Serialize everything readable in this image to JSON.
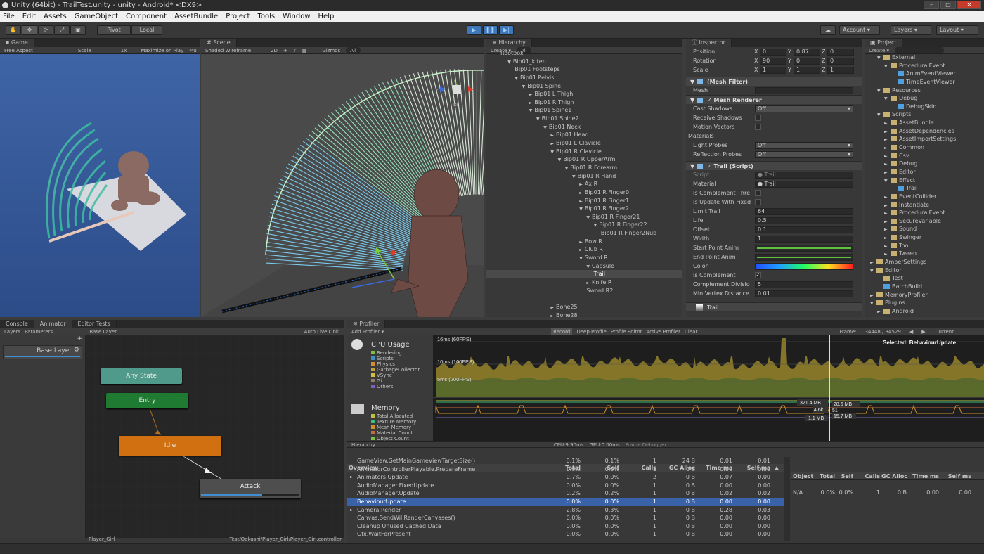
{
  "title": "Unity (64bit) - TrailTest.unity - unity - Android* <DX9>",
  "menu": [
    "File",
    "Edit",
    "Assets",
    "GameObject",
    "Component",
    "AssetBundle",
    "Project",
    "Tools",
    "Window",
    "Help"
  ],
  "toolbar": {
    "pivot": "Pivot",
    "local": "Local",
    "account": "Account",
    "layers": "Layers",
    "layout": "Layout"
  },
  "game": {
    "tab": "Game",
    "aspect": "Free Aspect",
    "scale_label": "Scale",
    "scale_value": "1x",
    "maximize": "Maximize on Play",
    "mute": "Mu"
  },
  "scene": {
    "tab": "Scene",
    "mode": "Shaded Wireframe",
    "twod": "2D",
    "gizmos": "Gizmos",
    "search": "All",
    "persp": "Iso"
  },
  "hierarchy": {
    "tab": "Hierarchy",
    "create": "Create",
    "search": "All",
    "rows": [
      {
        "t": "Rootbox",
        "d": 0,
        "a": ""
      },
      {
        "t": "Bip01_kiten",
        "d": 1,
        "a": "▼"
      },
      {
        "t": "Bip01 Footsteps",
        "d": 2,
        "a": ""
      },
      {
        "t": "Bip01 Pelvis",
        "d": 2,
        "a": "▼"
      },
      {
        "t": "Bip01 Spine",
        "d": 3,
        "a": "▼"
      },
      {
        "t": "Bip01 L Thigh",
        "d": 4,
        "a": "►"
      },
      {
        "t": "Bip01 R Thigh",
        "d": 4,
        "a": "►"
      },
      {
        "t": "Bip01 Spine1",
        "d": 4,
        "a": "▼"
      },
      {
        "t": "Bip01 Spine2",
        "d": 5,
        "a": "▼"
      },
      {
        "t": "Bip01 Neck",
        "d": 6,
        "a": "▼"
      },
      {
        "t": "Bip01 Head",
        "d": 7,
        "a": "►"
      },
      {
        "t": "Bip01 L Clavicle",
        "d": 7,
        "a": "►"
      },
      {
        "t": "Bip01 R Clavicle",
        "d": 7,
        "a": "▼"
      },
      {
        "t": "Bip01 R UpperArm",
        "d": 8,
        "a": "▼"
      },
      {
        "t": "Bip01 R Forearm",
        "d": 9,
        "a": "▼"
      },
      {
        "t": "Bip01 R Hand",
        "d": 10,
        "a": "▼"
      },
      {
        "t": "Ax R",
        "d": 11,
        "a": "►"
      },
      {
        "t": "Bip01 R Finger0",
        "d": 11,
        "a": "►"
      },
      {
        "t": "Bip01 R Finger1",
        "d": 11,
        "a": "►"
      },
      {
        "t": "Bip01 R Finger2",
        "d": 11,
        "a": "▼"
      },
      {
        "t": "Bip01 R Finger21",
        "d": 12,
        "a": "▼"
      },
      {
        "t": "Bip01 R Finger22",
        "d": 13,
        "a": "▼"
      },
      {
        "t": "Bip01 R Finger2Nub",
        "d": 14,
        "a": ""
      },
      {
        "t": "Bow R",
        "d": 11,
        "a": "►"
      },
      {
        "t": "Club R",
        "d": 11,
        "a": "►"
      },
      {
        "t": "Sword R",
        "d": 11,
        "a": "▼"
      },
      {
        "t": "Capsule",
        "d": 12,
        "a": "▼"
      },
      {
        "t": "Trail",
        "d": 13,
        "a": "",
        "sel": true
      },
      {
        "t": "Knife R",
        "d": 12,
        "a": "►"
      },
      {
        "t": "Sword R2",
        "d": 12,
        "a": ""
      },
      {
        "t": "",
        "d": 0,
        "a": ""
      },
      {
        "t": "Bone25",
        "d": 7,
        "a": "►"
      },
      {
        "t": "Bone28",
        "d": 7,
        "a": "►"
      }
    ]
  },
  "inspector": {
    "tab": "Inspector",
    "transform": [
      {
        "label": "Position",
        "x": "0",
        "y": "0.87",
        "z": "0"
      },
      {
        "label": "Rotation",
        "x": "90",
        "y": "0",
        "z": "0"
      },
      {
        "label": "Scale",
        "x": "1",
        "y": "1",
        "z": "1"
      }
    ],
    "xyz": [
      "X",
      "Y",
      "Z"
    ],
    "mesh_filter": {
      "title": "(Mesh Filter)",
      "mesh_label": "Mesh"
    },
    "mesh_renderer": {
      "title": "Mesh Renderer",
      "rows": [
        {
          "label": "Cast Shadows",
          "value": "Off",
          "kind": "drop"
        },
        {
          "label": "Receive Shadows",
          "value": "",
          "kind": "check"
        },
        {
          "label": "Motion Vectors",
          "value": "",
          "kind": "check"
        },
        {
          "label": "Materials",
          "value": "",
          "kind": "fold"
        },
        {
          "label": "Light Probes",
          "value": "Off",
          "kind": "drop"
        },
        {
          "label": "Reflection Probes",
          "value": "Off",
          "kind": "drop"
        }
      ]
    },
    "trail": {
      "title": "Trail (Script)",
      "rows": [
        {
          "label": "Script",
          "value": "Trail",
          "kind": "obj",
          "dim": true
        },
        {
          "label": "Material",
          "value": "Trail",
          "kind": "obj"
        },
        {
          "label": "Is Complement Thre",
          "value": "",
          "kind": "check"
        },
        {
          "label": "Is Update With Fixed",
          "value": "",
          "kind": "check"
        },
        {
          "label": "Limit Trail",
          "value": "64",
          "kind": "text"
        },
        {
          "label": "Life",
          "value": "0.5",
          "kind": "text"
        },
        {
          "label": "Offset",
          "value": "0.1",
          "kind": "text"
        },
        {
          "label": "Width",
          "value": "1",
          "kind": "text"
        },
        {
          "label": "Start Point Anim",
          "value": "",
          "kind": "curve"
        },
        {
          "label": "End Point Anim",
          "value": "",
          "kind": "curve"
        },
        {
          "label": "Color",
          "value": "",
          "kind": "gradient"
        },
        {
          "label": "Is Complement",
          "value": "✓",
          "kind": "checked"
        },
        {
          "label": "Complement Divisio",
          "value": "5",
          "kind": "text"
        },
        {
          "label": "Min Vertex Distance",
          "value": "0.01",
          "kind": "text"
        }
      ]
    },
    "footer": "Trail"
  },
  "project": {
    "tab": "Project",
    "create": "Create",
    "rows": [
      {
        "t": "External",
        "d": 1,
        "a": "▼",
        "f": true
      },
      {
        "t": "ProceduralEvent",
        "d": 2,
        "a": "▼",
        "f": true
      },
      {
        "t": "AnimEventViewer",
        "d": 3,
        "a": "",
        "f": false
      },
      {
        "t": "TimeEventViewer",
        "d": 3,
        "a": "",
        "f": false
      },
      {
        "t": "Resources",
        "d": 1,
        "a": "▼",
        "f": true
      },
      {
        "t": "Debug",
        "d": 2,
        "a": "▼",
        "f": true
      },
      {
        "t": "DebugSkin",
        "d": 3,
        "a": "",
        "f": false
      },
      {
        "t": "Scripts",
        "d": 1,
        "a": "▼",
        "f": true
      },
      {
        "t": "AssetBundle",
        "d": 2,
        "a": "►",
        "f": true
      },
      {
        "t": "AssetDependencies",
        "d": 2,
        "a": "►",
        "f": true
      },
      {
        "t": "AssetImportSettings",
        "d": 2,
        "a": "►",
        "f": true
      },
      {
        "t": "Common",
        "d": 2,
        "a": "►",
        "f": true
      },
      {
        "t": "Csv",
        "d": 2,
        "a": "►",
        "f": true
      },
      {
        "t": "Debug",
        "d": 2,
        "a": "►",
        "f": true
      },
      {
        "t": "Editor",
        "d": 2,
        "a": "►",
        "f": true
      },
      {
        "t": "Effect",
        "d": 2,
        "a": "▼",
        "f": true
      },
      {
        "t": "Trail",
        "d": 3,
        "a": "",
        "f": false
      },
      {
        "t": "EventCollider",
        "d": 2,
        "a": "►",
        "f": true
      },
      {
        "t": "Instantiate",
        "d": 2,
        "a": "►",
        "f": true
      },
      {
        "t": "ProceduralEvent",
        "d": 2,
        "a": "►",
        "f": true
      },
      {
        "t": "SecureVariable",
        "d": 2,
        "a": "►",
        "f": true
      },
      {
        "t": "Sound",
        "d": 2,
        "a": "►",
        "f": true
      },
      {
        "t": "Swinger",
        "d": 2,
        "a": "►",
        "f": true
      },
      {
        "t": "Tool",
        "d": 2,
        "a": "►",
        "f": true
      },
      {
        "t": "Tween",
        "d": 2,
        "a": "►",
        "f": true
      },
      {
        "t": "AmberSettings",
        "d": 0,
        "a": "►",
        "f": true
      },
      {
        "t": "Editor",
        "d": 0,
        "a": "▼",
        "f": true
      },
      {
        "t": "Test",
        "d": 1,
        "a": "",
        "f": true
      },
      {
        "t": "BatchBuild",
        "d": 1,
        "a": "",
        "f": false
      },
      {
        "t": "MemoryProfiler",
        "d": 0,
        "a": "►",
        "f": true
      },
      {
        "t": "Plugins",
        "d": 0,
        "a": "▼",
        "f": true
      },
      {
        "t": "Android",
        "d": 1,
        "a": "►",
        "f": true
      }
    ]
  },
  "animator": {
    "tabs": [
      "Console",
      "Animator",
      "Editor Tests"
    ],
    "sub": [
      "Layers",
      "Parameters"
    ],
    "breadcrumb": "Base Layer",
    "auto_live": "Auto Live Link",
    "layer_name": "Base Layer",
    "nodes": {
      "any": "Any State",
      "entry": "Entry",
      "idle": "Idle",
      "attack": "Attack"
    },
    "footer_left": "Player_Girl",
    "footer_right": "Test/Ookushi/Player_Girl/Player_Girl.controller"
  },
  "profiler": {
    "tab": "Profiler",
    "add": "Add Profiler",
    "controls": [
      "Record",
      "Deep Profile",
      "Profile Editor",
      "Active Profiler",
      "Clear"
    ],
    "frame_label": "Frame:",
    "frame_value": "34448 / 34529",
    "current": "Current",
    "cpu_title": "CPU Usage",
    "cpu_legend": [
      {
        "name": "Rendering",
        "color": "#7fbf3f"
      },
      {
        "name": "Scripts",
        "color": "#3f8fbf"
      },
      {
        "name": "Physics",
        "color": "#d08f2f"
      },
      {
        "name": "GarbageCollector",
        "color": "#c0a040"
      },
      {
        "name": "VSync",
        "color": "#d0c040"
      },
      {
        "name": "Gi",
        "color": "#8f7f6f"
      },
      {
        "name": "Others",
        "color": "#7f5fbf"
      }
    ],
    "mem_title": "Memory",
    "mem_legend": [
      {
        "name": "Total Allocated",
        "color": "#c0c040"
      },
      {
        "name": "Texture Memory",
        "color": "#3fbf7f"
      },
      {
        "name": "Mesh Memory",
        "color": "#d08f2f"
      },
      {
        "name": "Material Count",
        "color": "#bf6f3f"
      },
      {
        "name": "Object Count",
        "color": "#7fbf3f"
      }
    ],
    "guides": [
      "16ms (60FPS)",
      "10ms (100FPS)",
      "5ms (200FPS)"
    ],
    "selected": "Selected: BehaviourUpdate",
    "mem_labels": [
      "321.4 MB",
      "28.6 MB",
      "4.6k",
      "51",
      "15.7 MB",
      "1.1 MB"
    ],
    "hier_mode": "Hierarchy",
    "cpu_time": "CPU:9.90ms",
    "gpu_time": "GPU:0.00ms",
    "frame_debugger": "Frame Debugger",
    "cols": [
      "Overview",
      "Total",
      "Self",
      "Calls",
      "GC Alloc",
      "Time ms",
      "Self ms"
    ],
    "rows": [
      {
        "name": "GameView.GetMainGameViewTargetSize()",
        "total": "0.1%",
        "self": "0.1%",
        "calls": "1",
        "gc": "24 B",
        "time": "0.01",
        "selfms": "0.01"
      },
      {
        "name": "AnimatorControllerPlayable.PrepareFrame",
        "total": "0.0%",
        "self": "0.0%",
        "calls": "1",
        "gc": "0 B",
        "time": "0.00",
        "selfms": "0.00"
      },
      {
        "name": "Animators.Update",
        "total": "0.7%",
        "self": "0.0%",
        "calls": "2",
        "gc": "0 B",
        "time": "0.07",
        "selfms": "0.00",
        "arrow": true
      },
      {
        "name": "AudioManager.FixedUpdate",
        "total": "0.0%",
        "self": "0.0%",
        "calls": "1",
        "gc": "0 B",
        "time": "0.00",
        "selfms": "0.00"
      },
      {
        "name": "AudioManager.Update",
        "total": "0.2%",
        "self": "0.2%",
        "calls": "1",
        "gc": "0 B",
        "time": "0.02",
        "selfms": "0.02"
      },
      {
        "name": "BehaviourUpdate",
        "total": "0.0%",
        "self": "0.0%",
        "calls": "1",
        "gc": "0 B",
        "time": "0.00",
        "selfms": "0.00",
        "sel": true
      },
      {
        "name": "Camera.Render",
        "total": "2.8%",
        "self": "0.3%",
        "calls": "1",
        "gc": "0 B",
        "time": "0.28",
        "selfms": "0.03",
        "arrow": true
      },
      {
        "name": "Canvas.SendWillRenderCanvases()",
        "total": "0.0%",
        "self": "0.0%",
        "calls": "1",
        "gc": "0 B",
        "time": "0.00",
        "selfms": "0.00"
      },
      {
        "name": "Cleanup Unused Cached Data",
        "total": "0.0%",
        "self": "0.0%",
        "calls": "1",
        "gc": "0 B",
        "time": "0.00",
        "selfms": "0.00"
      },
      {
        "name": "Gfx.WaitForPresent",
        "total": "0.0%",
        "self": "0.0%",
        "calls": "1",
        "gc": "0 B",
        "time": "0.00",
        "selfms": "0.00"
      }
    ],
    "objcols": [
      "Object",
      "Total",
      "Self",
      "Calls",
      "GC Alloc",
      "Time ms",
      "Self ms"
    ],
    "objrow": {
      "object": "N/A",
      "total": "0.0%",
      "self": "0.0%",
      "calls": "1",
      "gc": "0 B",
      "time": "0.00",
      "selfms": "0.00"
    }
  }
}
